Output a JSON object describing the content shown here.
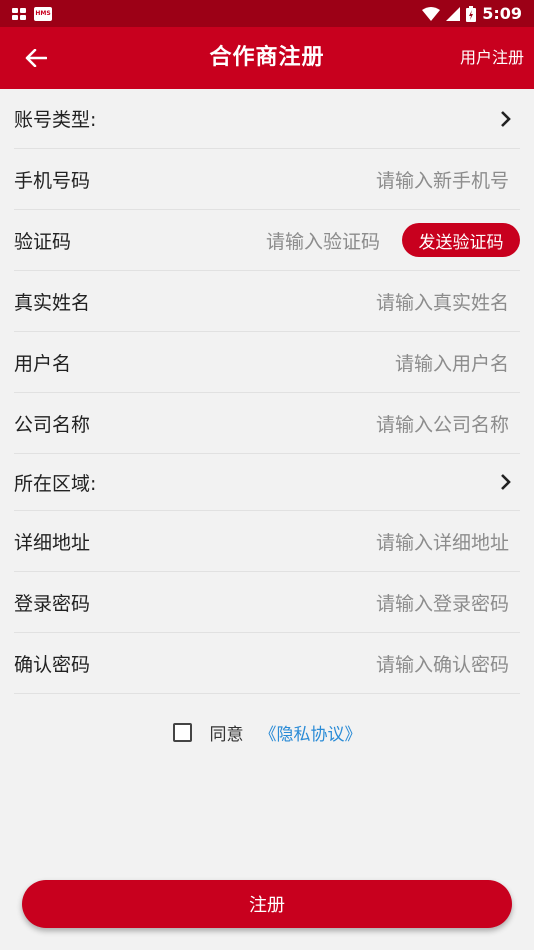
{
  "status_bar": {
    "time": "5:09",
    "left_icons": [
      "grid-icon",
      "hms-icon"
    ],
    "hms_label": "HMS"
  },
  "app_bar": {
    "title": "合作商注册",
    "right_action": "用户注册",
    "back_icon": "arrow-left-icon"
  },
  "colors": {
    "primary": "#c8001e",
    "status_bar": "#9c0016",
    "link": "#2a8bd6",
    "background": "#f2f2f2"
  },
  "form": {
    "account_type": {
      "label": "账号类型:"
    },
    "phone": {
      "label": "手机号码",
      "placeholder": "请输入新手机号"
    },
    "verify_code": {
      "label": "验证码",
      "placeholder": "请输入验证码",
      "button": "发送验证码"
    },
    "real_name": {
      "label": "真实姓名",
      "placeholder": "请输入真实姓名"
    },
    "username": {
      "label": "用户名",
      "placeholder": "请输入用户名"
    },
    "company": {
      "label": "公司名称",
      "placeholder": "请输入公司名称"
    },
    "region": {
      "label": "所在区域:"
    },
    "address": {
      "label": "详细地址",
      "placeholder": "请输入详细地址"
    },
    "password": {
      "label": "登录密码",
      "placeholder": "请输入登录密码"
    },
    "confirm_password": {
      "label": "确认密码",
      "placeholder": "请输入确认密码"
    }
  },
  "agreement": {
    "checked": false,
    "text": "同意",
    "link": "《隐私协议》"
  },
  "submit": {
    "label": "注册"
  }
}
